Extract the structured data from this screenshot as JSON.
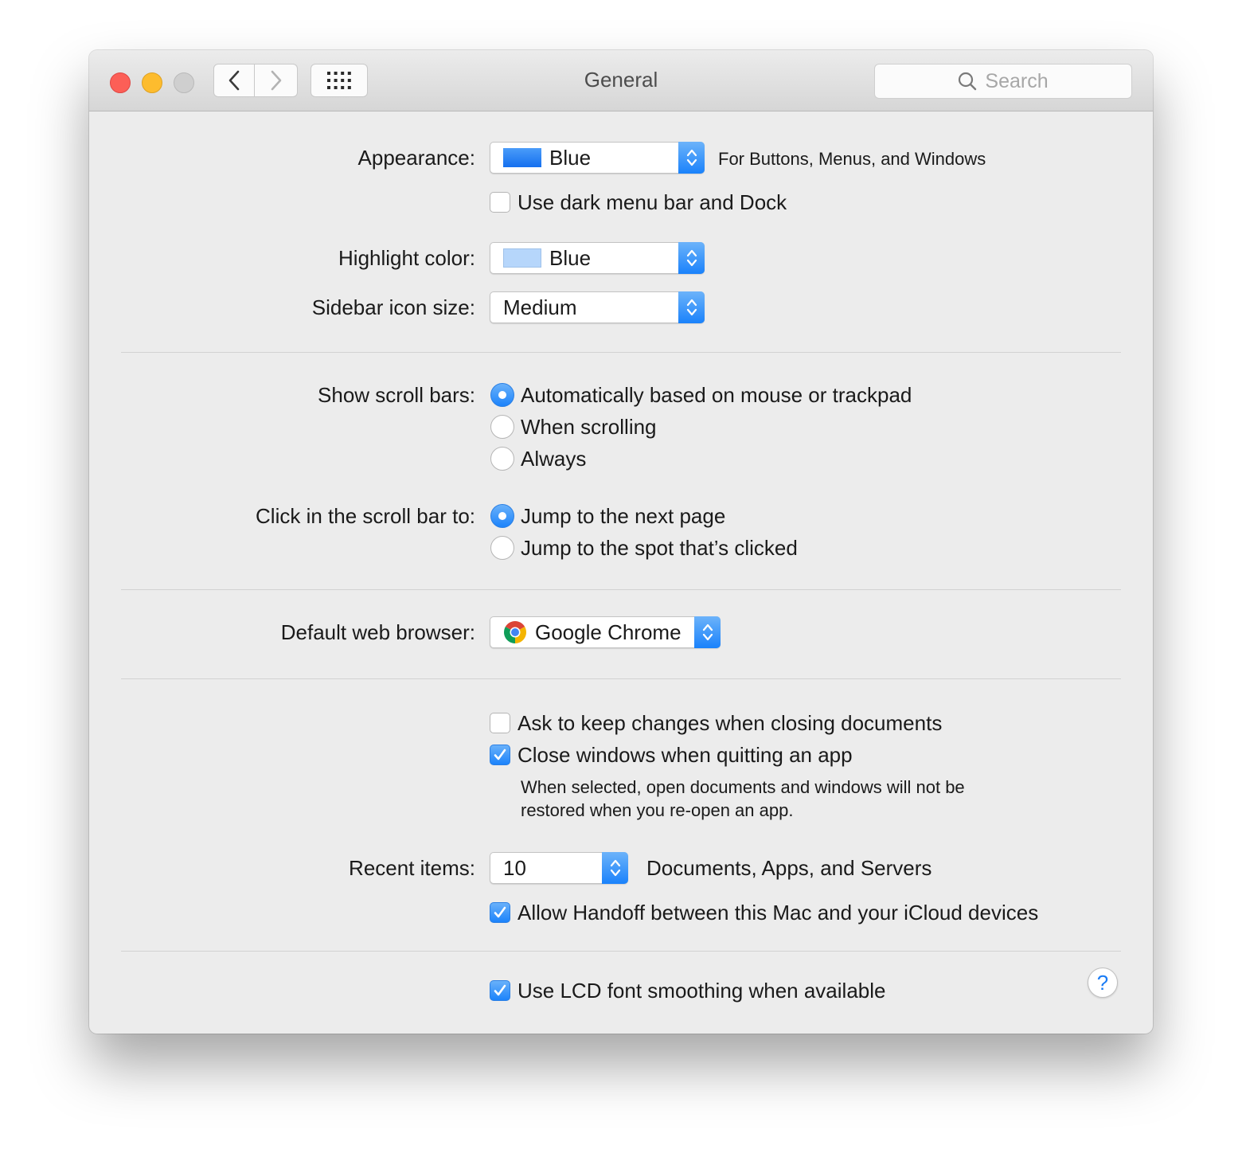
{
  "window": {
    "title": "General"
  },
  "toolbar": {
    "search_placeholder": "Search",
    "back_icon": "chevron-left-icon",
    "forward_icon": "chevron-right-icon",
    "grid_icon": "grid-icon"
  },
  "appearance": {
    "label": "Appearance:",
    "value": "Blue",
    "swatch_color": "#1a7ff5",
    "hint": "For Buttons, Menus, and Windows",
    "dark_menu_label": "Use dark menu bar and Dock",
    "dark_menu_checked": false
  },
  "highlight": {
    "label": "Highlight color:",
    "value": "Blue",
    "swatch_color": "#b6d6fb"
  },
  "sidebar_icon": {
    "label": "Sidebar icon size:",
    "value": "Medium"
  },
  "scroll_bars": {
    "label": "Show scroll bars:",
    "options": [
      "Automatically based on mouse or trackpad",
      "When scrolling",
      "Always"
    ],
    "selected": 0
  },
  "click_scroll": {
    "label": "Click in the scroll bar to:",
    "options": [
      "Jump to the next page",
      "Jump to the spot that’s clicked"
    ],
    "selected": 0
  },
  "browser": {
    "label": "Default web browser:",
    "value": "Google Chrome"
  },
  "documents": {
    "ask_keep_label": "Ask to keep changes when closing documents",
    "ask_keep_checked": false,
    "close_windows_label": "Close windows when quitting an app",
    "close_windows_checked": true,
    "note_line1": "When selected, open documents and windows will not be",
    "note_line2": "restored when you re-open an app."
  },
  "recent": {
    "label": "Recent items:",
    "value": "10",
    "suffix": "Documents, Apps, and Servers"
  },
  "handoff": {
    "label": "Allow Handoff between this Mac and your iCloud devices",
    "checked": true
  },
  "lcd": {
    "label": "Use LCD font smoothing when available",
    "checked": true
  },
  "help": {
    "symbol": "?"
  },
  "colors": {
    "accent": "#1c83fb",
    "window_bg": "#ececec"
  }
}
